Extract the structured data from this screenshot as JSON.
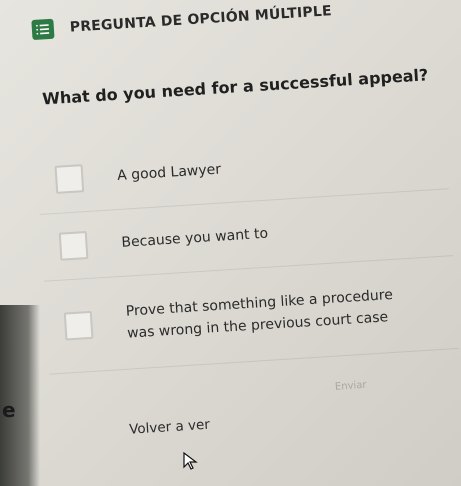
{
  "header": {
    "icon": "list-check-icon",
    "title": "PREGUNTA DE OPCIÓN MÚLTIPLE",
    "icon_color": "#2d7a45"
  },
  "question": {
    "text": "What do you need for a successful appeal?"
  },
  "options": [
    {
      "label": "A good Lawyer"
    },
    {
      "label": "Because you want to"
    },
    {
      "label": "Prove that something like a procedure was wrong in the previous court case"
    }
  ],
  "actions": {
    "send_label": "Enviar",
    "back_label": "Volver a ver"
  },
  "misc": {
    "left_edge_text": "e",
    "cursor_icon": "mouse-pointer-icon"
  }
}
